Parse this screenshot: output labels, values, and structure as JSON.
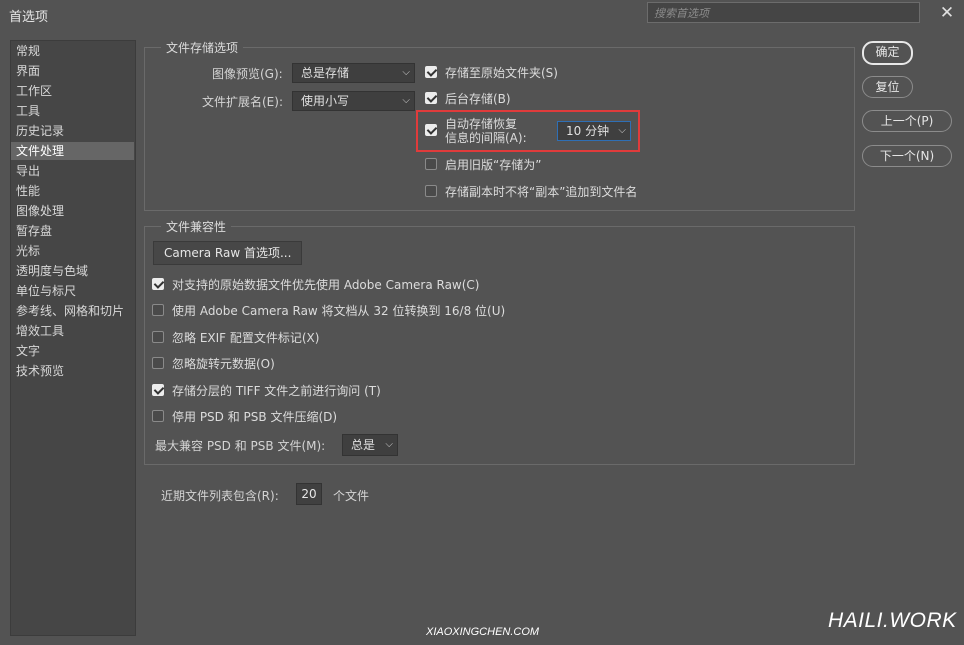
{
  "window": {
    "title": "首选项",
    "search_placeholder": "搜索首选项",
    "close_glyph": "✕"
  },
  "sidebar": {
    "items": [
      "常规",
      "界面",
      "工作区",
      "工具",
      "历史记录",
      "文件处理",
      "导出",
      "性能",
      "图像处理",
      "暂存盘",
      "光标",
      "透明度与色域",
      "单位与标尺",
      "参考线、网格和切片",
      "增效工具",
      "文字",
      "技术预览"
    ],
    "active_index": 5
  },
  "file_save": {
    "title": "文件存储选项",
    "image_preview_label": "图像预览(G):",
    "image_preview_value": "总是存储",
    "extension_label": "文件扩展名(E):",
    "extension_value": "使用小写",
    "options": [
      {
        "label": "存储至原始文件夹(S)",
        "checked": true
      },
      {
        "label": "后台存储(B)",
        "checked": true
      },
      {
        "label": "自动存储恢复",
        "label2": "信息的间隔(A):",
        "checked": true
      },
      {
        "label": "启用旧版“存储为”",
        "checked": false
      },
      {
        "label": "存储副本时不将“副本”追加到文件名",
        "checked": false
      }
    ],
    "autosave_interval": "10 分钟"
  },
  "compat": {
    "title": "文件兼容性",
    "camera_raw_button": "Camera Raw 首选项...",
    "options": [
      {
        "label": "对支持的原始数据文件优先使用 Adobe Camera Raw(C)",
        "checked": true
      },
      {
        "label": "使用 Adobe Camera Raw 将文档从 32 位转换到 16/8 位(U)",
        "checked": false
      },
      {
        "label": "忽略 EXIF 配置文件标记(X)",
        "checked": false
      },
      {
        "label": "忽略旋转元数据(O)",
        "checked": false
      },
      {
        "label": "存储分层的 TIFF 文件之前进行询问 (T)",
        "checked": true
      },
      {
        "label": "停用 PSD 和 PSB 文件压缩(D)",
        "checked": false
      }
    ],
    "max_compat_label": "最大兼容 PSD 和 PSB 文件(M):",
    "max_compat_value": "总是"
  },
  "recent": {
    "label": "近期文件列表包含(R):",
    "value": "20",
    "suffix": "个文件"
  },
  "buttons": {
    "ok": "确定",
    "reset": "复位",
    "prev": "上一个(P)",
    "next": "下一个(N)"
  },
  "watermarks": {
    "brand": "HAILI.WORK",
    "site": "XIAOXINGCHEN.COM"
  },
  "colors": {
    "background": "#535353",
    "highlight": "#e03b3b"
  }
}
